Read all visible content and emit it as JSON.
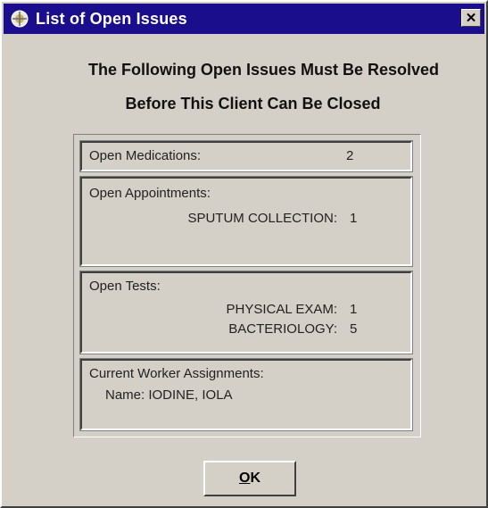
{
  "window": {
    "title": "List of Open Issues",
    "close_glyph": "✕"
  },
  "heading": {
    "line1": "The Following Open Issues Must Be Resolved",
    "line2": "Before This Client Can Be Closed"
  },
  "medications": {
    "label": "Open Medications:",
    "count": "2"
  },
  "appointments": {
    "label": "Open Appointments:",
    "items": [
      {
        "name": "SPUTUM COLLECTION:",
        "count": "1"
      }
    ]
  },
  "tests": {
    "label": "Open Tests:",
    "items": [
      {
        "name": "PHYSICAL EXAM:",
        "count": "1"
      },
      {
        "name": "BACTERIOLOGY:",
        "count": "5"
      }
    ]
  },
  "workers": {
    "label": "Current Worker Assignments:",
    "name_line": "Name: IODINE, IOLA"
  },
  "ok_button": {
    "mnemonic": "O",
    "rest": "K"
  },
  "colors": {
    "titlebar": "#1a0e8c",
    "face": "#d4d0c8"
  },
  "icons": {
    "app": "app-icon",
    "close": "close-icon"
  }
}
